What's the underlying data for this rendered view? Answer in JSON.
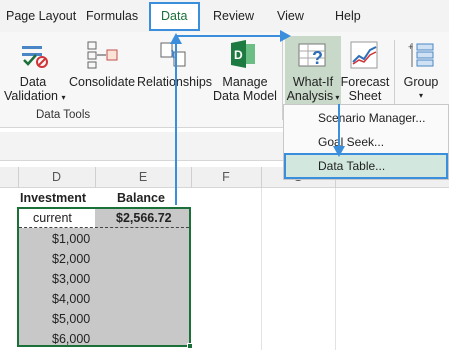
{
  "tabs": {
    "page_layout": "Page Layout",
    "formulas": "Formulas",
    "data": "Data",
    "review": "Review",
    "view": "View",
    "help": "Help"
  },
  "ribbon": {
    "data_validation": [
      "Data",
      "Validation"
    ],
    "consolidate": "Consolidate",
    "relationships": "Relationships",
    "manage_data_model": [
      "Manage",
      "Data Model"
    ],
    "what_if": [
      "What-If",
      "Analysis"
    ],
    "forecast_sheet": [
      "Forecast",
      "Sheet"
    ],
    "group": "Group",
    "group_name": "Data Tools"
  },
  "menu": {
    "scenario_manager": "Scenario Manager...",
    "goal_seek": "Goal Seek...",
    "data_table": "Data Table..."
  },
  "columns": [
    "D",
    "E",
    "F",
    "G"
  ],
  "sheet": {
    "header_investment": "Investment",
    "header_balance": "Balance",
    "current_label": "current",
    "current_balance": "$2,566.72",
    "investments": [
      "$1,000",
      "$2,000",
      "$3,000",
      "$4,000",
      "$5,000",
      "$6,000"
    ]
  },
  "colors": {
    "accent_blue": "#3b8edc",
    "excel_green": "#1b7039",
    "menu_highlight": "#d2e8df"
  }
}
